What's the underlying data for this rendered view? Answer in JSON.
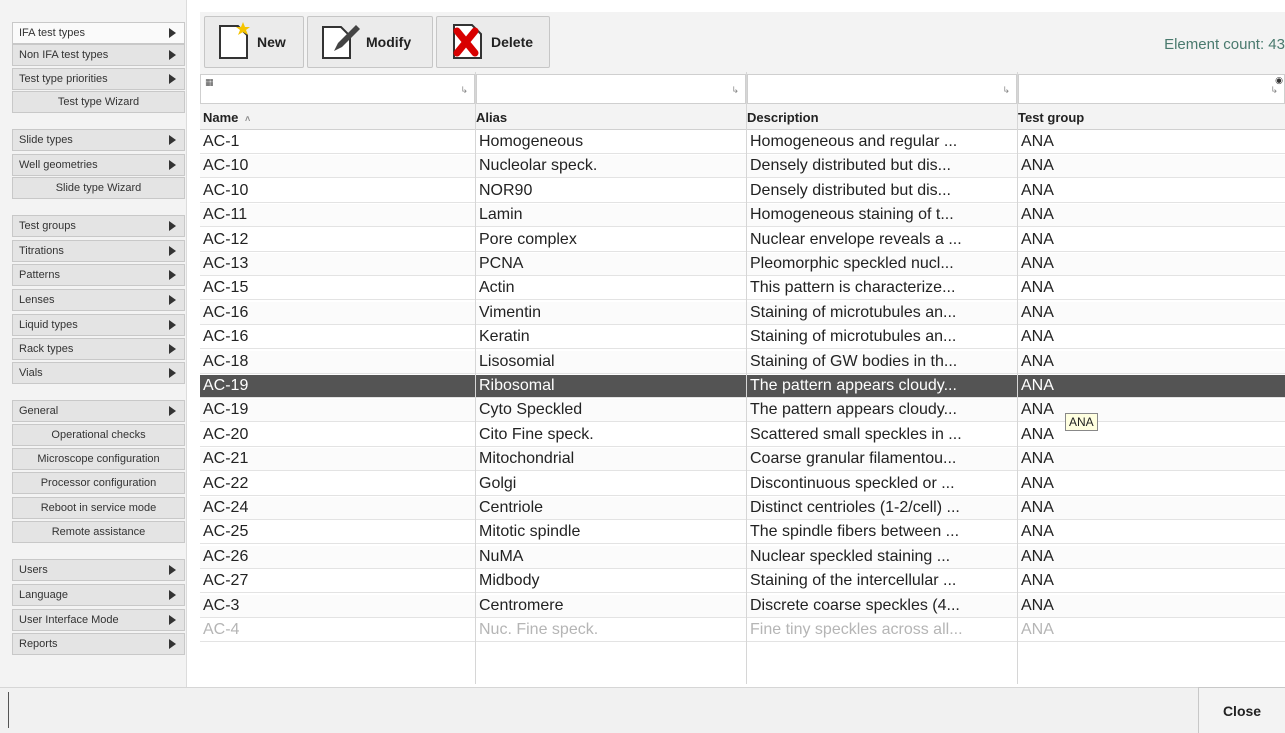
{
  "sidebar": {
    "groups": [
      [
        {
          "label": "IFA test types",
          "arrow": true,
          "align": "left"
        },
        {
          "label": "Non IFA test types",
          "arrow": true,
          "align": "left"
        },
        {
          "label": "Test type priorities",
          "arrow": true,
          "align": "left"
        },
        {
          "label": "Test type Wizard",
          "arrow": false,
          "align": "center"
        }
      ],
      [
        {
          "label": "Slide types",
          "arrow": true,
          "align": "left"
        },
        {
          "label": "Well geometries",
          "arrow": true,
          "align": "left"
        },
        {
          "label": "Slide type Wizard",
          "arrow": false,
          "align": "center"
        }
      ],
      [
        {
          "label": "Test groups",
          "arrow": true,
          "align": "left"
        },
        {
          "label": "Titrations",
          "arrow": true,
          "align": "left"
        },
        {
          "label": "Patterns",
          "arrow": true,
          "align": "left"
        },
        {
          "label": "Lenses",
          "arrow": true,
          "align": "left"
        },
        {
          "label": "Liquid types",
          "arrow": true,
          "align": "left"
        },
        {
          "label": "Rack types",
          "arrow": true,
          "align": "left"
        },
        {
          "label": "Vials",
          "arrow": true,
          "align": "left"
        }
      ],
      [
        {
          "label": "General",
          "arrow": true,
          "align": "left"
        },
        {
          "label": "Operational checks",
          "arrow": false,
          "align": "center"
        },
        {
          "label": "Microscope configuration",
          "arrow": false,
          "align": "center"
        },
        {
          "label": "Processor configuration",
          "arrow": false,
          "align": "center"
        },
        {
          "label": "Reboot in service mode",
          "arrow": false,
          "align": "center"
        },
        {
          "label": "Remote assistance",
          "arrow": false,
          "align": "center"
        }
      ],
      [
        {
          "label": "Users",
          "arrow": true,
          "align": "left"
        },
        {
          "label": "Language",
          "arrow": true,
          "align": "left"
        },
        {
          "label": "User Interface Mode",
          "arrow": true,
          "align": "left"
        },
        {
          "label": "Reports",
          "arrow": true,
          "align": "left"
        }
      ]
    ]
  },
  "toolbar": {
    "new_label": "New",
    "modify_label": "Modify",
    "delete_label": "Delete",
    "element_count": "Element count: 43"
  },
  "table": {
    "headers": [
      "Name",
      "Alias",
      "Description",
      "Test group"
    ],
    "selected_index": 10,
    "tooltip": "ANA",
    "rows": [
      [
        "AC-1",
        "Homogeneous",
        "Homogeneous and regular ...",
        "ANA"
      ],
      [
        "AC-10",
        "Nucleolar speck.",
        "Densely distributed but dis...",
        "ANA"
      ],
      [
        "AC-10",
        "NOR90",
        "Densely distributed but dis...",
        "ANA"
      ],
      [
        "AC-11",
        "Lamin",
        "Homogeneous staining of t...",
        "ANA"
      ],
      [
        "AC-12",
        "Pore complex",
        "Nuclear envelope reveals a ...",
        "ANA"
      ],
      [
        "AC-13",
        "PCNA",
        "Pleomorphic speckled nucl...",
        "ANA"
      ],
      [
        "AC-15",
        "Actin",
        "This pattern is characterize...",
        "ANA"
      ],
      [
        "AC-16",
        "Vimentin",
        "Staining of microtubules an...",
        "ANA"
      ],
      [
        "AC-16",
        "Keratin",
        "Staining of microtubules an...",
        "ANA"
      ],
      [
        "AC-18",
        "Lisosomial",
        "Staining of GW bodies in th...",
        "ANA"
      ],
      [
        "AC-19",
        "Ribosomal",
        "The pattern appears cloudy...",
        "ANA"
      ],
      [
        "AC-19",
        "Cyto Speckled",
        "The pattern appears cloudy...",
        "ANA"
      ],
      [
        "AC-20",
        "Cito Fine speck.",
        "Scattered small speckles in ...",
        "ANA"
      ],
      [
        "AC-21",
        "Mitochondrial",
        "Coarse granular filamentou...",
        "ANA"
      ],
      [
        "AC-22",
        "Golgi",
        "Discontinuous speckled or ...",
        "ANA"
      ],
      [
        "AC-24",
        "Centriole",
        "Distinct centrioles (1-2/cell) ...",
        "ANA"
      ],
      [
        "AC-25",
        "Mitotic spindle",
        "The spindle fibers between ...",
        "ANA"
      ],
      [
        "AC-26",
        "NuMA",
        "Nuclear speckled staining ...",
        "ANA"
      ],
      [
        "AC-27",
        "Midbody",
        "Staining of the intercellular ...",
        "ANA"
      ],
      [
        "AC-3",
        "Centromere",
        "Discrete coarse speckles (4...",
        "ANA"
      ],
      [
        "AC-4",
        "Nuc. Fine speck.",
        "Fine tiny speckles across all...",
        "ANA"
      ]
    ]
  },
  "footer": {
    "close_label": "Close"
  }
}
